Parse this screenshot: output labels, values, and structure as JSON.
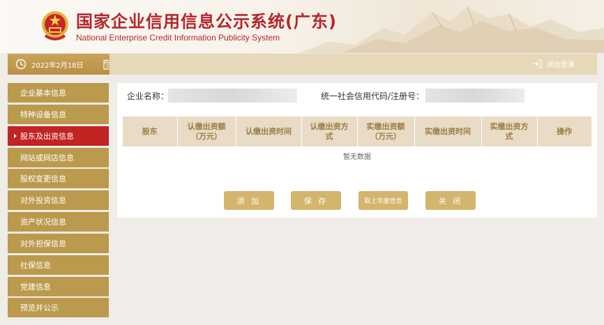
{
  "header": {
    "title_cn": "国家企业信用信息公示系统(广东)",
    "title_en": "National Enterprise Credit Information Publicity System",
    "brand_color": "#b3262a"
  },
  "topbar": {
    "date": "2022年2月18日",
    "logout_label": "退出登录"
  },
  "sidebar": {
    "items": [
      {
        "label": "企业基本信息",
        "active": false
      },
      {
        "label": "特种设备信息",
        "active": false
      },
      {
        "label": "股东及出资信息",
        "active": true
      },
      {
        "label": "网站或网店信息",
        "active": false
      },
      {
        "label": "股权变更信息",
        "active": false
      },
      {
        "label": "对外投资信息",
        "active": false
      },
      {
        "label": "资产状况信息",
        "active": false
      },
      {
        "label": "对外担保信息",
        "active": false
      },
      {
        "label": "社保信息",
        "active": false
      },
      {
        "label": "党建信息",
        "active": false
      },
      {
        "label": "预览并公示",
        "active": false
      }
    ],
    "color": "#bb9a4d",
    "active_color": "#c22323"
  },
  "main": {
    "company_name_label": "企业名称：",
    "credit_code_label": "统一社会信用代码/注册号：",
    "table": {
      "headers": [
        {
          "line1": "股东",
          "line2": ""
        },
        {
          "line1": "认缴出资额",
          "line2": "（万元）"
        },
        {
          "line1": "认缴出资时间",
          "line2": ""
        },
        {
          "line1": "认缴出资方",
          "line2": "式"
        },
        {
          "line1": "实缴出资额",
          "line2": "（万元）"
        },
        {
          "line1": "实缴出资时间",
          "line2": ""
        },
        {
          "line1": "实缴出资方",
          "line2": "式"
        },
        {
          "line1": "操作",
          "line2": ""
        }
      ],
      "empty_text": "暂无数据"
    },
    "buttons": {
      "add": "添 加",
      "save": "保 存",
      "prev_year": "取上年度信息",
      "close": "关 闭"
    }
  }
}
